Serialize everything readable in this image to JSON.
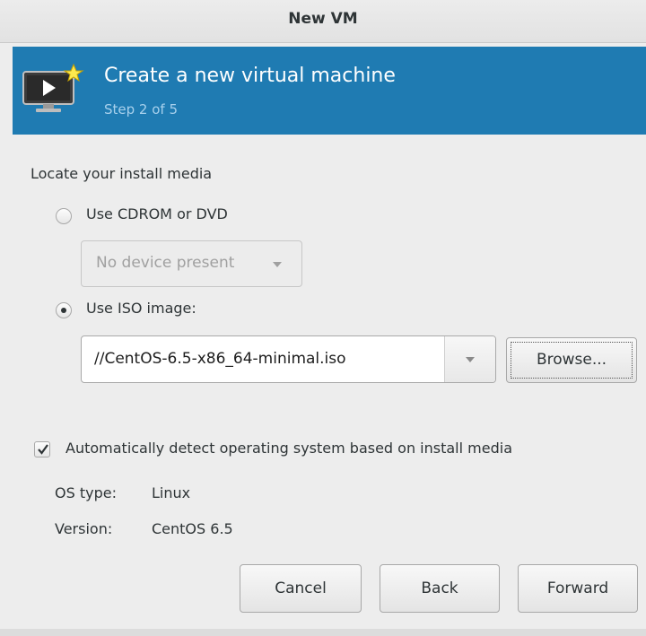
{
  "window": {
    "title": "New VM"
  },
  "header": {
    "title": "Create a new virtual machine",
    "step": "Step 2 of 5",
    "icon": "monitor-play-new-icon",
    "accent_color": "#1f7bb2"
  },
  "media": {
    "section_label": "Locate your install media",
    "cdrom": {
      "label": "Use CDROM or DVD",
      "selected": false,
      "device_value": "No device present"
    },
    "iso": {
      "label": "Use ISO image:",
      "selected": true,
      "path_value": "//CentOS-6.5-x86_64-minimal.iso",
      "browse_label": "Browse..."
    }
  },
  "os_detection": {
    "auto_detect_label": "Automatically detect operating system based on install media",
    "checked": true,
    "os_type_label": "OS type:",
    "os_type_value": "Linux",
    "version_label": "Version:",
    "version_value": "CentOS 6.5"
  },
  "buttons": {
    "cancel": "Cancel",
    "back": "Back",
    "forward": "Forward"
  }
}
